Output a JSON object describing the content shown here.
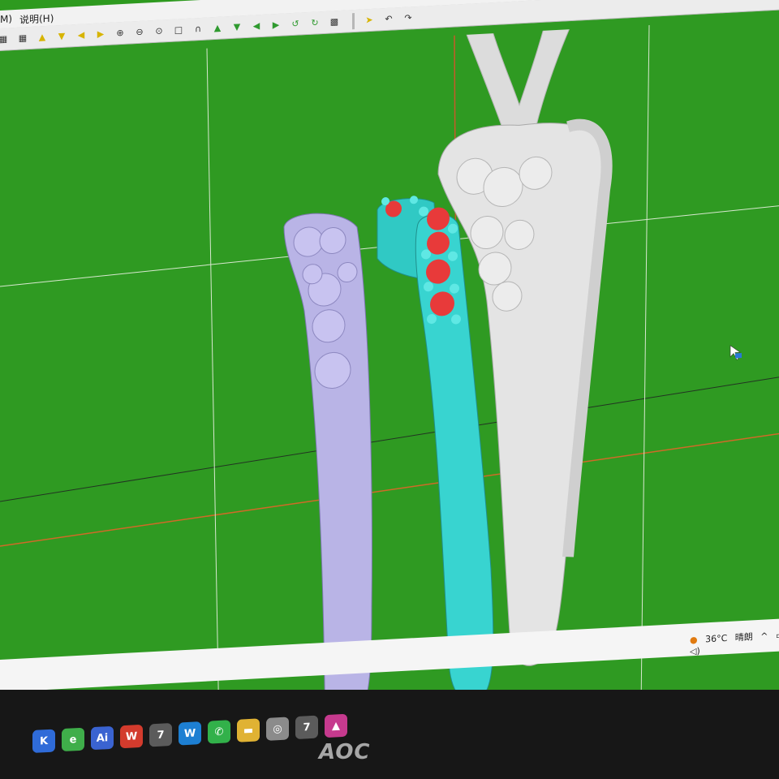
{
  "menubar": {
    "items": [
      "M)",
      "说明(H)"
    ]
  },
  "toolbar": {
    "icons": [
      "grid-icon",
      "grid-icon",
      "triangle-up-icon",
      "triangle-down-icon",
      "triangle-left-icon",
      "triangle-right-icon",
      "zoom-in-icon",
      "zoom-out-icon",
      "zoom-fit-icon",
      "box-icon",
      "headset-icon",
      "arrow-up-icon",
      "arrow-down-icon",
      "arrow-left-icon",
      "arrow-right-icon",
      "rotate-left-icon",
      "rotate-right-icon",
      "grid-edit-icon",
      "pointer-icon",
      "undo-icon",
      "redo-icon"
    ]
  },
  "tray": {
    "temperature": "36°C",
    "weather": "晴朗"
  },
  "monitor": {
    "brand": "AOC"
  },
  "apps": [
    {
      "icon": "k-app-icon",
      "label": "K",
      "color": "#2f6bd8"
    },
    {
      "icon": "browser-icon",
      "label": "e",
      "color": "#3fae4a"
    },
    {
      "icon": "ai-icon",
      "label": "Ai",
      "color": "#3a63d1"
    },
    {
      "icon": "wps-icon",
      "label": "W",
      "color": "#d33b2d"
    },
    {
      "icon": "rhino-icon",
      "label": "7",
      "color": "#5b5b5b"
    },
    {
      "icon": "w-app-icon",
      "label": "W",
      "color": "#1d7fd2"
    },
    {
      "icon": "wechat-icon",
      "label": "✆",
      "color": "#32b14a"
    },
    {
      "icon": "folder-icon",
      "label": "▬",
      "color": "#e0b233"
    },
    {
      "icon": "ring-app-icon",
      "label": "◎",
      "color": "#8b8b8b"
    },
    {
      "icon": "rhino2-icon",
      "label": "7",
      "color": "#5b5b5b"
    },
    {
      "icon": "paint-icon",
      "label": "▲",
      "color": "#c63a8e"
    }
  ],
  "colors": {
    "viewport": "#2f9a22",
    "ring_purple": "#b9b4e6",
    "ring_cyan": "#35d6d2",
    "ring_white": "#e6e6e6",
    "gem_red": "#e83a3a"
  }
}
